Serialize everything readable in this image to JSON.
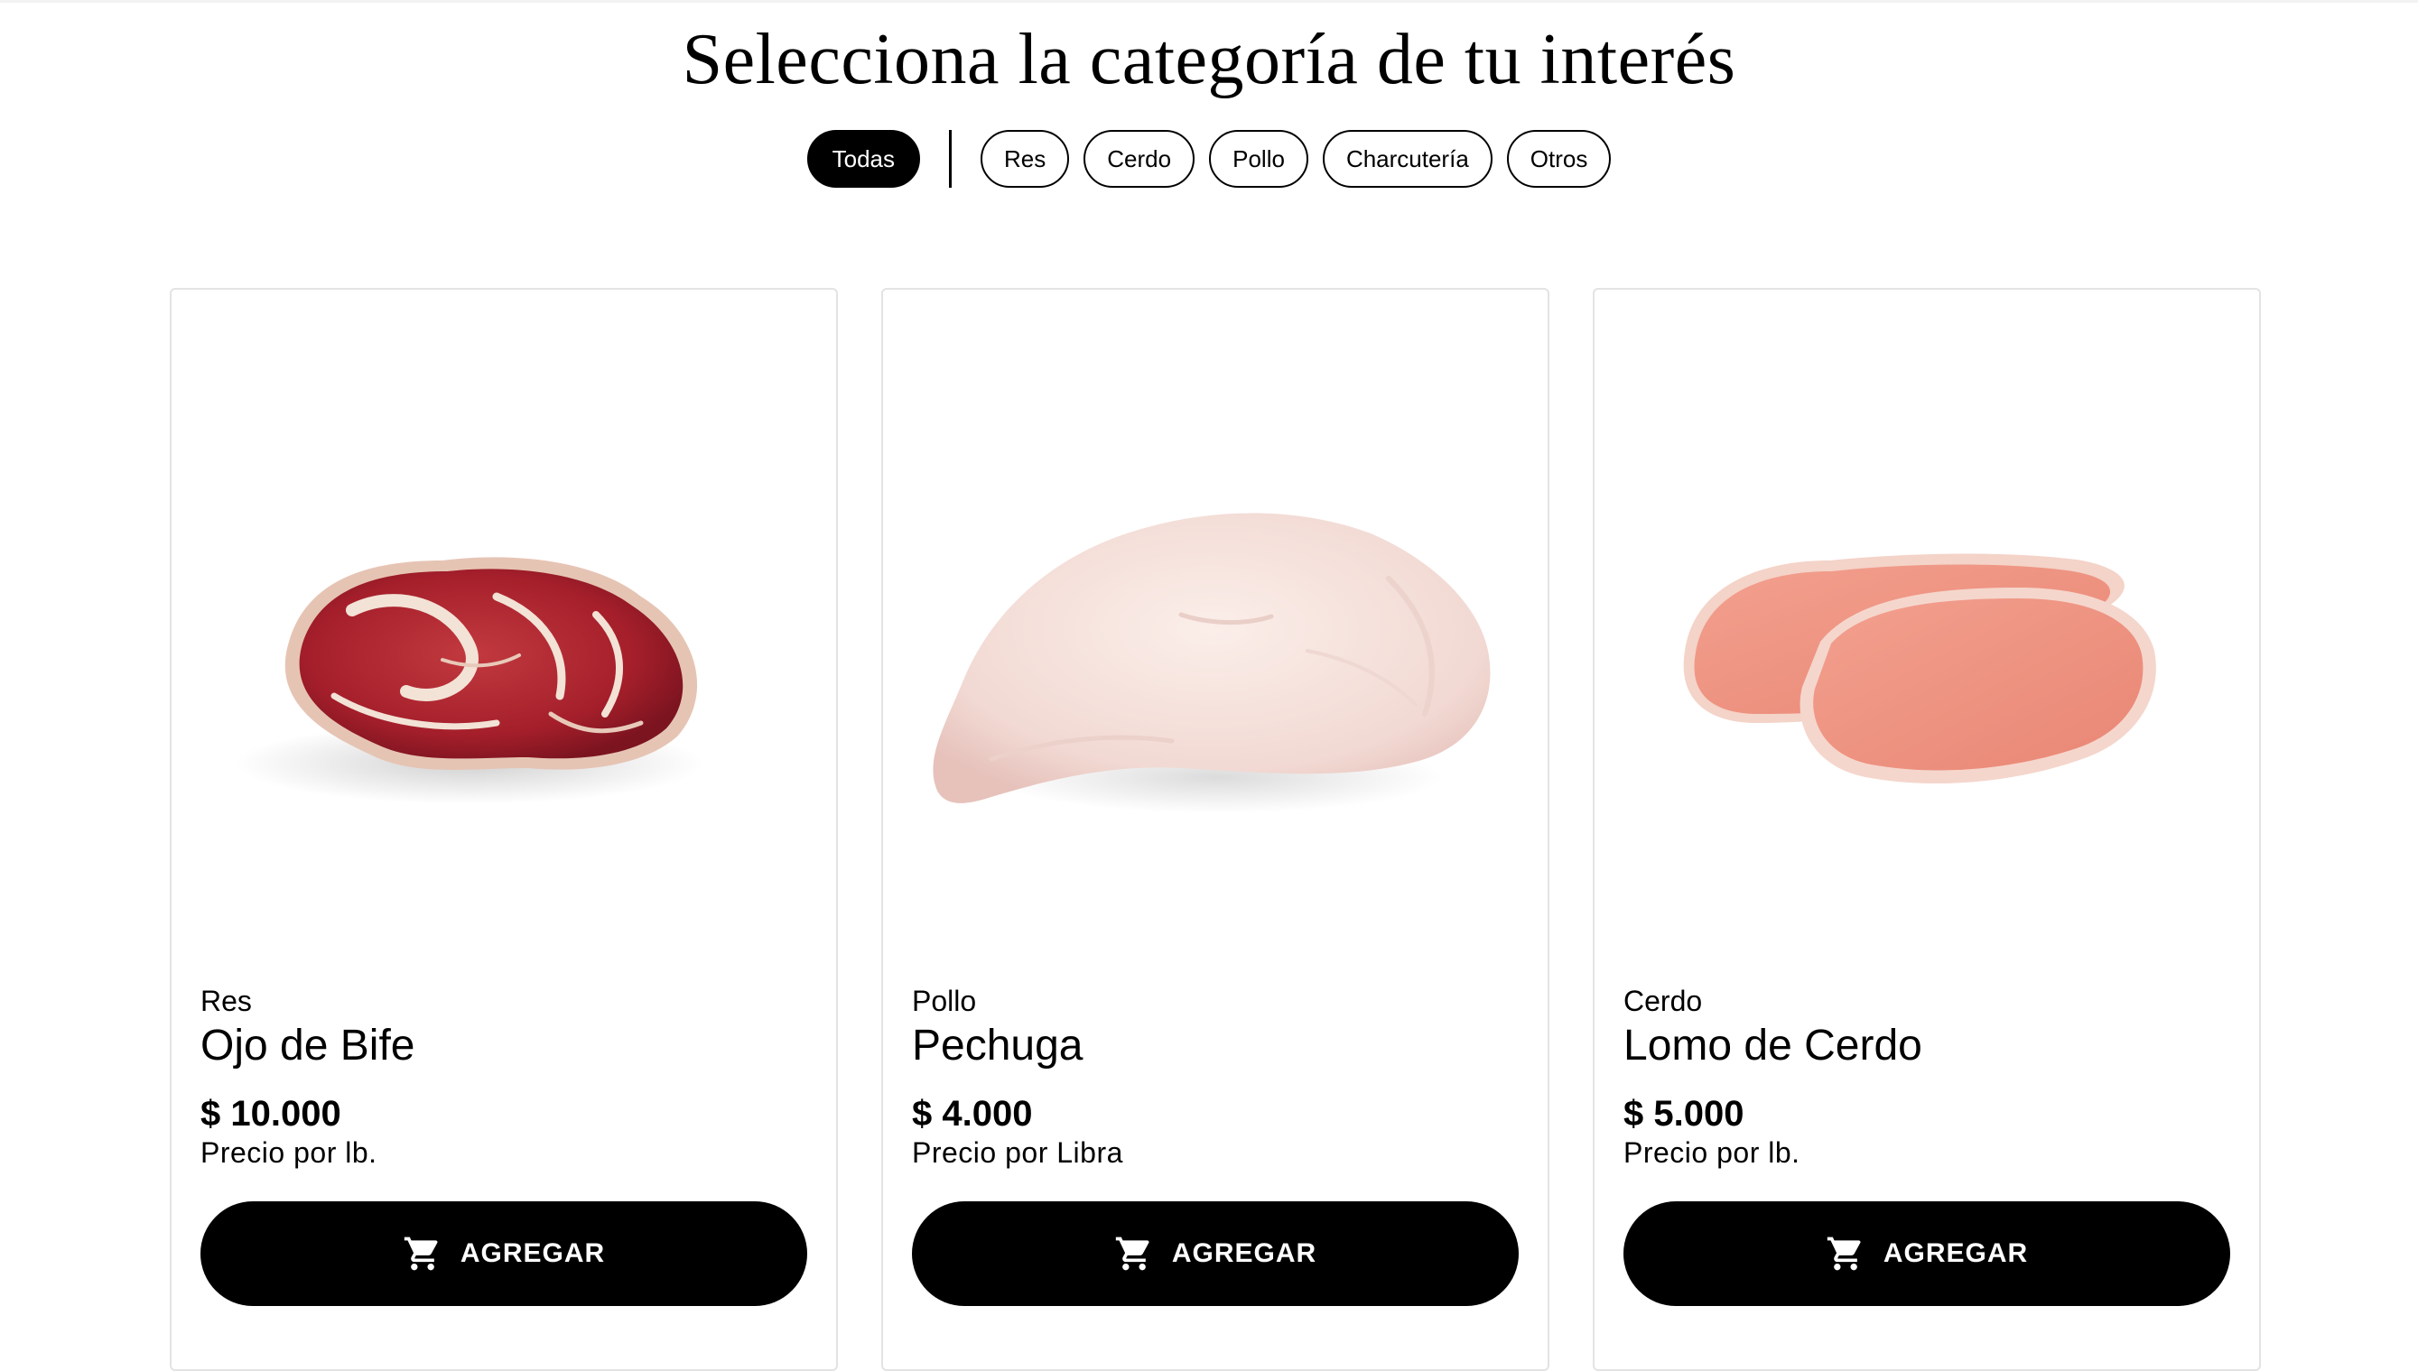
{
  "page": {
    "heading": "Selecciona la categoría de tu interés"
  },
  "filters": {
    "all": "Todas",
    "items": [
      "Res",
      "Cerdo",
      "Pollo",
      "Charcutería",
      "Otros"
    ],
    "selected": "Todas"
  },
  "products": [
    {
      "category": "Res",
      "name": "Ojo de Bife",
      "price": "$ 10.000",
      "price_note": "Precio por lb.",
      "button_label": "AGREGAR",
      "image_icon": "beef-steak-image"
    },
    {
      "category": "Pollo",
      "name": "Pechuga",
      "price": "$ 4.000",
      "price_note": "Precio por Libra",
      "button_label": "AGREGAR",
      "image_icon": "chicken-breast-image"
    },
    {
      "category": "Cerdo",
      "name": "Lomo de Cerdo",
      "price": "$ 5.000",
      "price_note": "Precio por lb.",
      "button_label": "AGREGAR",
      "image_icon": "pork-loin-image"
    }
  ],
  "colors": {
    "primary": "#000000",
    "background": "#ffffff",
    "card_border": "#e3e3e3"
  }
}
